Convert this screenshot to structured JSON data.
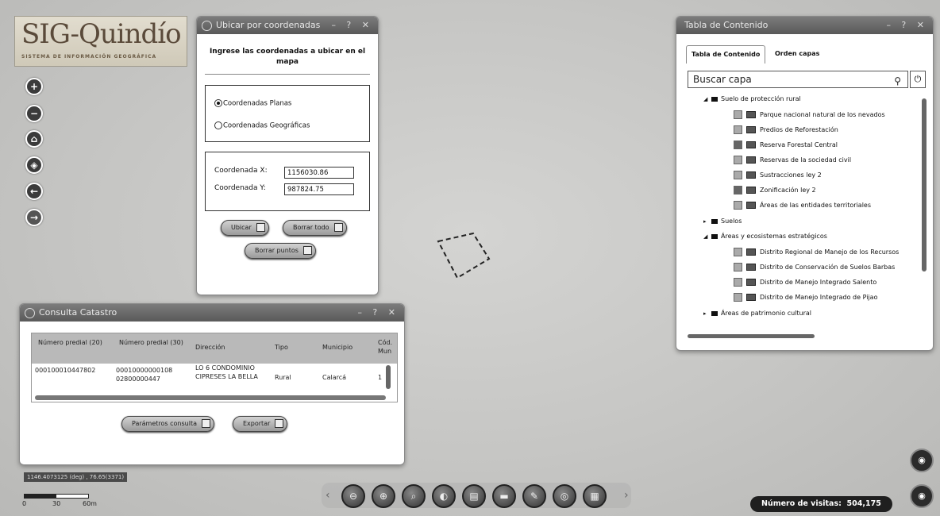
{
  "logo": {
    "title": "SIG-Quindío",
    "subtitle": "SISTEMA DE INFORMACIÓN GEOGRÁFICA"
  },
  "nav": [
    {
      "icon": "zoom-in-icon",
      "glyph": "+"
    },
    {
      "icon": "zoom-out-icon",
      "glyph": "−"
    },
    {
      "icon": "home-icon",
      "glyph": "⌂"
    },
    {
      "icon": "locate-icon",
      "glyph": "◈"
    },
    {
      "icon": "back-icon",
      "glyph": "←"
    },
    {
      "icon": "forward-icon",
      "glyph": "→"
    }
  ],
  "ubicar": {
    "title": "Ubicar por coordenadas",
    "heading": "Ingrese las coordenadas a ubicar en el mapa",
    "radio_planas": "Coordenadas Planas",
    "radio_geograficas": "Coordenadas Geográficas",
    "x_label": "Coordenada X:",
    "x_value": "1156030.86",
    "y_label": "Coordenada Y:",
    "y_value": "987824.75",
    "btn_ubicar": "Ubicar",
    "btn_borrar_todo": "Borrar todo",
    "btn_borrar_puntos": "Borrar puntos"
  },
  "catastro": {
    "title": "Consulta Catastro",
    "columns": [
      "Número predial (20)",
      "Número predial (30)",
      "Dirección",
      "Tipo",
      "Municipio",
      "Cód. Mun"
    ],
    "rows": [
      [
        "000100010447802",
        "00010000000108 02800000447",
        "LO 6 CONDOMINIO CIPRESES LA BELLA",
        "Rural",
        "Calarcá",
        "1"
      ]
    ],
    "btn_parametros": "Parámetros consulta",
    "btn_exportar": "Exportar"
  },
  "tabla": {
    "title": "Tabla de Contenido",
    "tab_contenido": "Tabla de Contenido",
    "tab_orden": "Orden capas",
    "search_placeholder": "Buscar capa",
    "tree": {
      "suelo_proteccion": "Suelo de protección rural",
      "layers1": [
        {
          "label": "Parque nacional natural de los nevados",
          "checked": false
        },
        {
          "label": "Predios de Reforestación",
          "checked": false
        },
        {
          "label": "Reserva Forestal Central",
          "checked": true
        },
        {
          "label": "Reservas de la sociedad civil",
          "checked": false
        },
        {
          "label": "Sustracciones ley 2",
          "checked": false
        },
        {
          "label": "Zonificación ley 2",
          "checked": true
        },
        {
          "label": "Áreas de las entidades territoriales",
          "checked": false
        }
      ],
      "suelos": "Suelos",
      "areas_ecosistemas": "Áreas y ecosistemas estratégicos",
      "layers2": [
        {
          "label": "Distrito Regional de Manejo de los Recursos",
          "checked": false
        },
        {
          "label": "Distrito de Conservación de Suelos Barbas",
          "checked": false
        },
        {
          "label": "Distrito de Manejo Integrado Salento",
          "checked": false
        },
        {
          "label": "Distrito de Manejo Integrado de Pijao",
          "checked": false
        }
      ],
      "areas_patrimonio": "Áreas de patrimonio cultural"
    }
  },
  "coords_readout": "1146.4073125 (deg) , 76.65(3371)",
  "scale": {
    "labels": [
      "0",
      "30",
      "60m"
    ]
  },
  "toolbar": [
    {
      "icon": "measure-icon",
      "glyph": "⊖"
    },
    {
      "icon": "crosshair-icon",
      "glyph": "⊕"
    },
    {
      "icon": "search-map-icon",
      "glyph": "⌕"
    },
    {
      "icon": "globe-icon",
      "glyph": "◐"
    },
    {
      "icon": "print-icon",
      "glyph": "▤"
    },
    {
      "icon": "layers-icon",
      "glyph": "▬"
    },
    {
      "icon": "draw-icon",
      "glyph": "✎"
    },
    {
      "icon": "share-icon",
      "glyph": "◎"
    },
    {
      "icon": "table-icon",
      "glyph": "▦"
    }
  ],
  "toolbar_prev": "‹",
  "toolbar_next": "›",
  "visits": {
    "label": "Número de visitas:",
    "value": "504,175"
  },
  "window_controls": "– ? ✕"
}
